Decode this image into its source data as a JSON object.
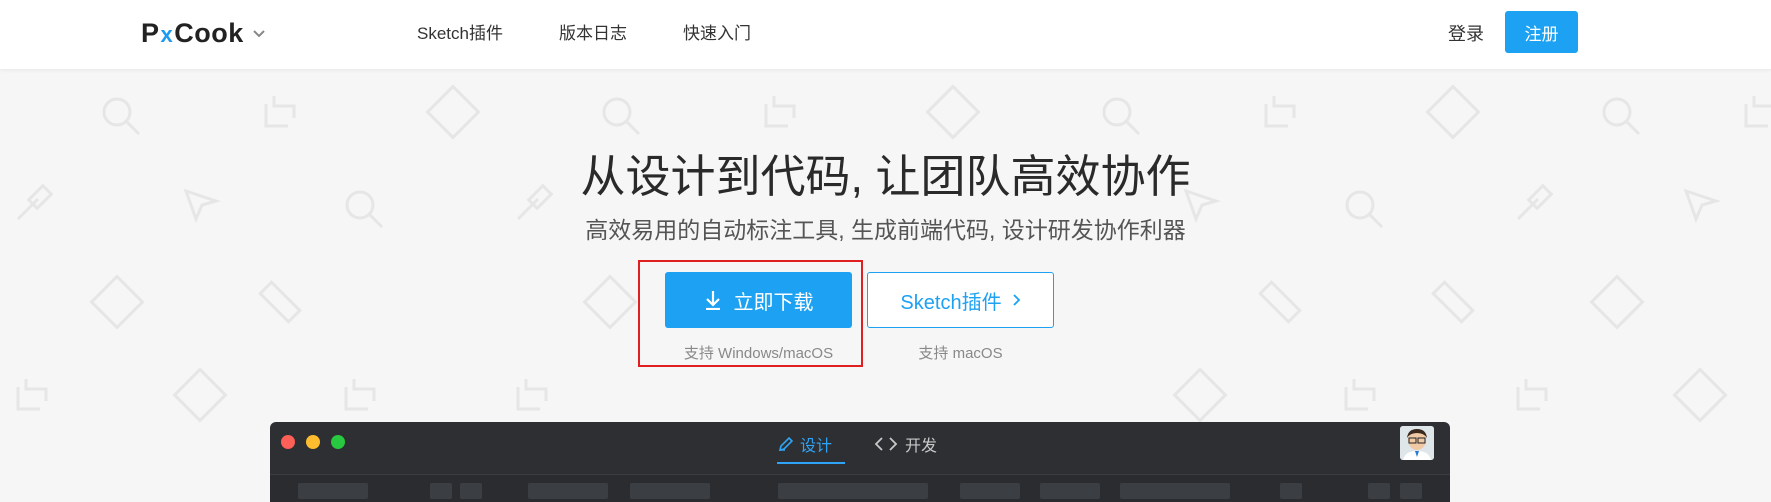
{
  "header": {
    "logo": {
      "text_left": "P",
      "text_x": "x",
      "text_right": "Cook"
    },
    "nav": [
      {
        "label": "Sketch插件"
      },
      {
        "label": "版本日志"
      },
      {
        "label": "快速入门"
      }
    ],
    "login_label": "登录",
    "register_label": "注册"
  },
  "hero": {
    "title": "从设计到代码, 让团队高效协作",
    "subtitle": "高效易用的自动标注工具, 生成前端代码, 设计研发协作利器",
    "download_button_label": "立即下载",
    "sketch_button_label": "Sketch插件",
    "download_note": "支持 Windows/macOS",
    "sketch_note": "支持 macOS"
  },
  "app_preview": {
    "tabs": [
      {
        "label": "设计",
        "active": true
      },
      {
        "label": "开发",
        "active": false
      }
    ]
  },
  "icons": {
    "logo_dropdown": "chevron-down-icon",
    "download": "download-arrow-icon",
    "sketch_more": "chevron-right-icon",
    "design_tab": "pencil-icon",
    "dev_tab": "code-brackets-icon"
  },
  "colors": {
    "accent": "#1da1f2",
    "highlight": "#e02020",
    "app_bg": "#2d2f33"
  }
}
